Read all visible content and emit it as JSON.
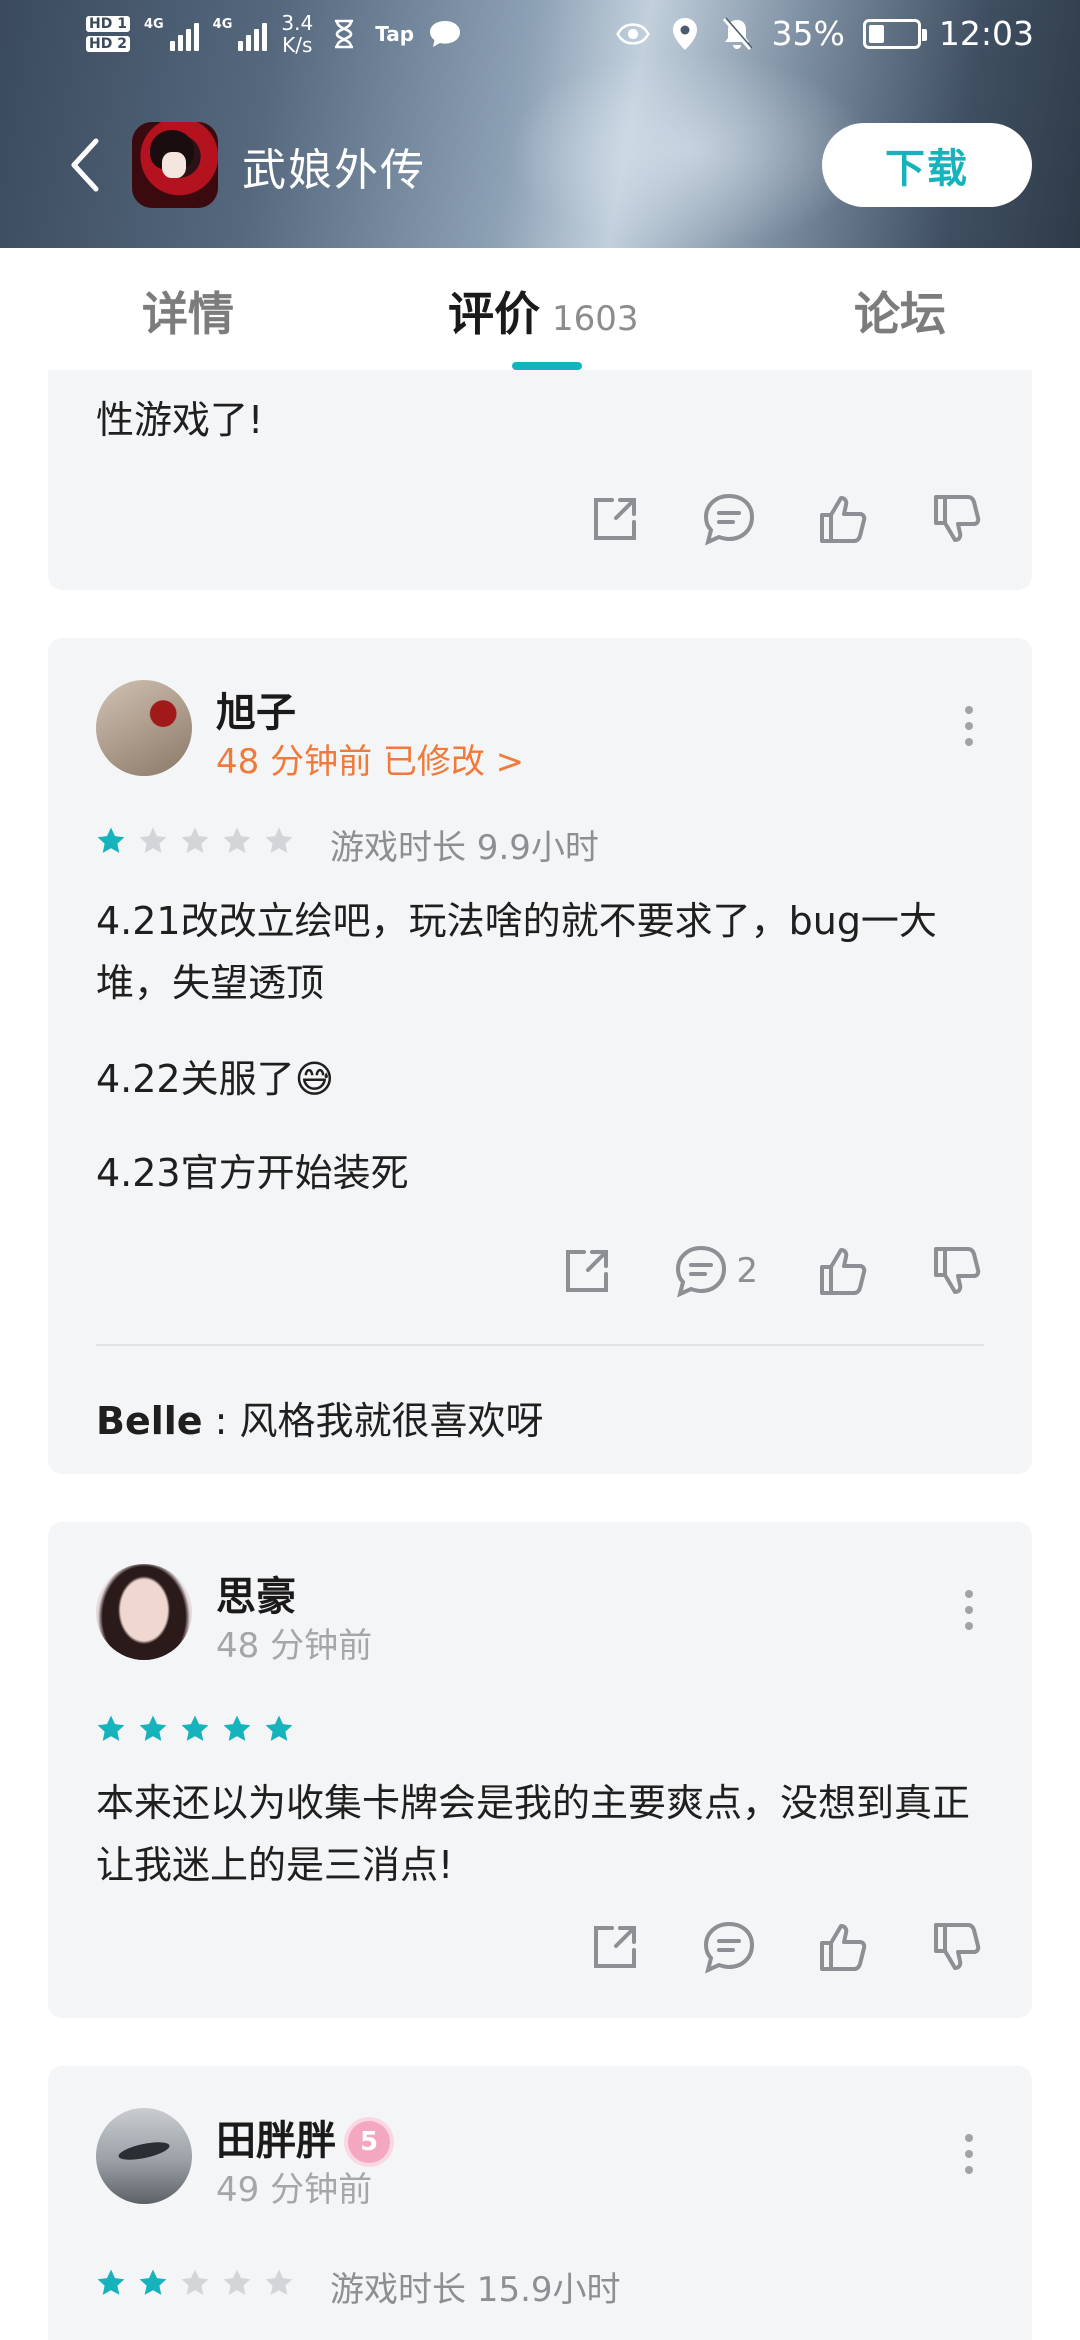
{
  "status_bar": {
    "hd1": "HD 1",
    "hd2": "HD 2",
    "net1": "4G",
    "net2": "4G",
    "speed_value": "3.4",
    "speed_unit": "K/s",
    "tap_label": "Tap",
    "battery": "35%",
    "time": "12:03"
  },
  "app_bar": {
    "title": "武娘外传",
    "download_label": "下载"
  },
  "tabs": [
    {
      "label": "详情"
    },
    {
      "label": "评价",
      "count": "1603"
    },
    {
      "label": "论坛"
    }
  ],
  "reviews": [
    {
      "body_partial": "性游戏了!"
    },
    {
      "user": "旭子",
      "time": "48 分钟前 已修改 >",
      "rating": 1,
      "playtime": "游戏时长 9.9小时",
      "paragraphs": [
        "4.21改改立绘吧，玩法啥的就不要求了，bug一大堆，失望透顶",
        "4.22关服了😅",
        "4.23官方开始装死"
      ],
      "comment_count": "2",
      "reply_user": "Belle",
      "reply_text": " : 风格我就很喜欢呀"
    },
    {
      "user": "思豪",
      "time": "48 分钟前",
      "rating": 5,
      "paragraphs": [
        "本来还以为收集卡牌会是我的主要爽点，没想到真正让我迷上的是三消点!"
      ]
    },
    {
      "user": "田胖胖",
      "badge": "5",
      "time": "49 分钟前",
      "rating": 2,
      "playtime": "游戏时长 15.9小时"
    }
  ],
  "colors": {
    "accent": "#17b3bd",
    "edited": "#f07a3a",
    "star_empty": "#d3d5d8"
  }
}
